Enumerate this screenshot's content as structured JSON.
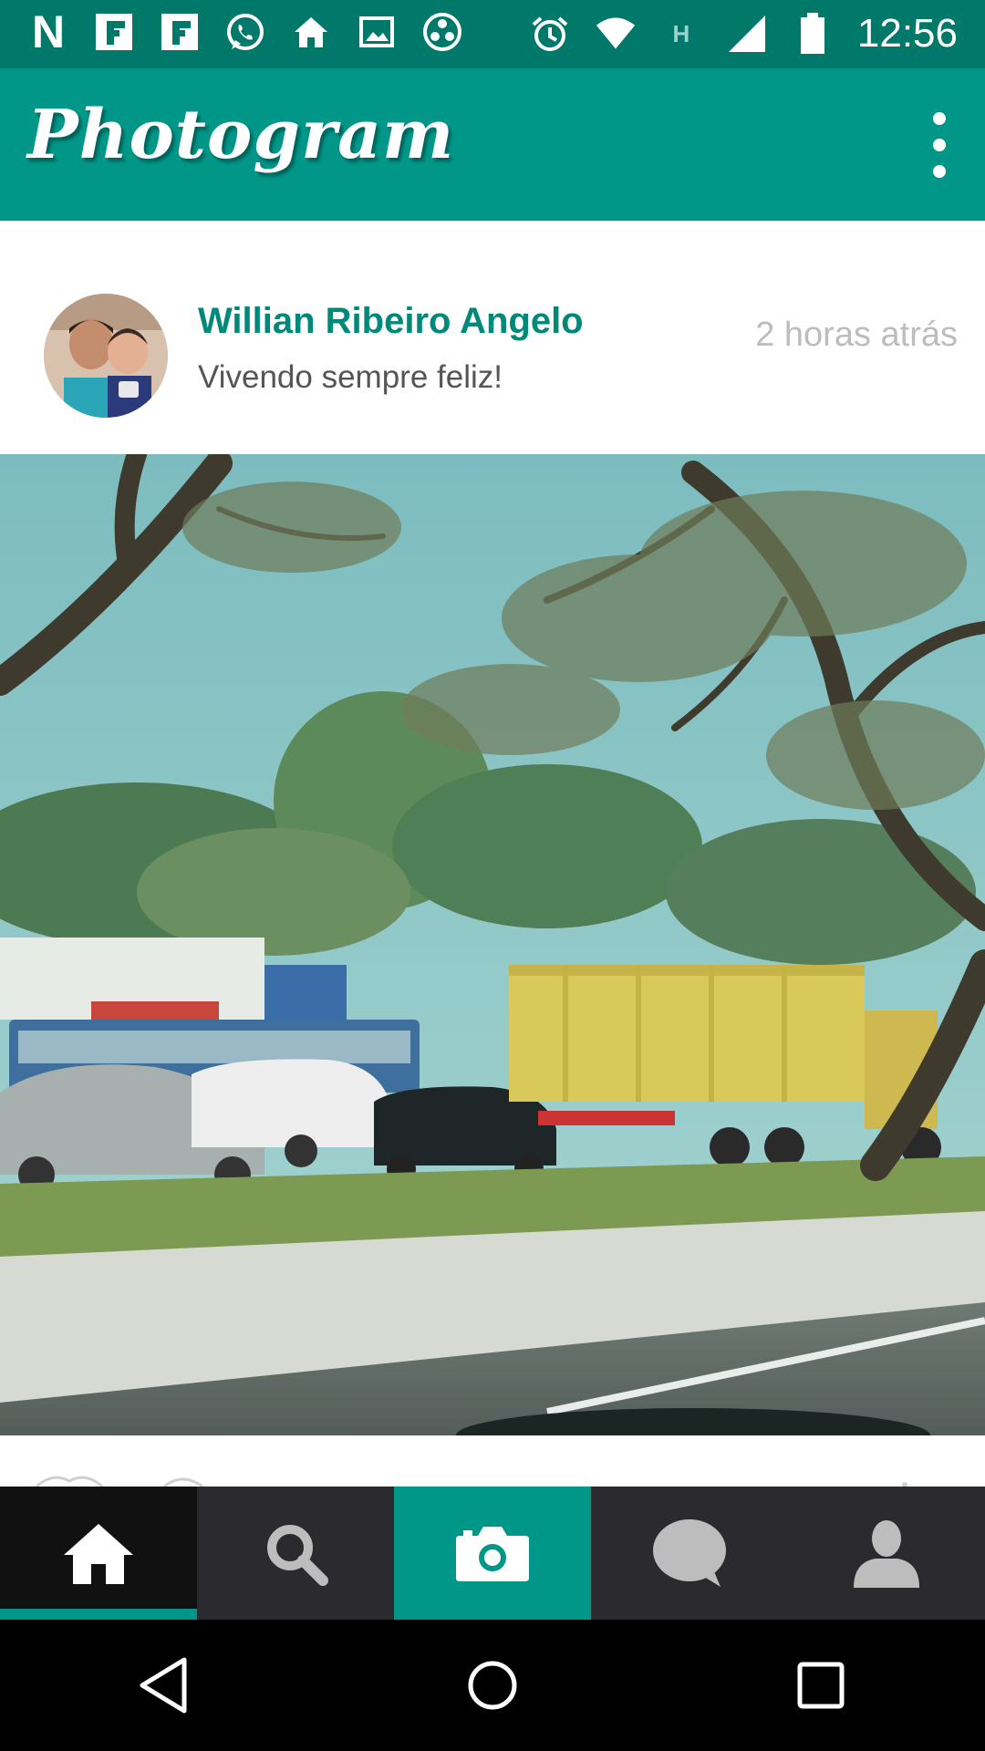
{
  "status_bar": {
    "time": "12:56",
    "left_icons": [
      "n-icon",
      "flipboard-icon",
      "flipboard-icon",
      "whatsapp-icon",
      "home-icon",
      "gallery-icon",
      "reel-icon"
    ],
    "right_icons": [
      "alarm-icon",
      "wifi-icon",
      "h-signal-icon",
      "cell-signal-icon",
      "battery-icon"
    ],
    "n_letter": "N",
    "h_letter": "H"
  },
  "app_bar": {
    "title": "Photogram"
  },
  "post": {
    "author": "Willian Ribeiro Angelo",
    "caption": "Vivendo sempre feliz!",
    "time": "2 horas atrás"
  },
  "bottom_nav": {
    "tabs": [
      {
        "name": "home",
        "active": true
      },
      {
        "name": "search",
        "active": false
      },
      {
        "name": "camera",
        "active": false
      },
      {
        "name": "messages",
        "active": false
      },
      {
        "name": "profile",
        "active": false
      }
    ]
  },
  "colors": {
    "status_bar": "#00796b",
    "app_bar": "#009688",
    "accent": "#00897b",
    "nav_bg": "#2b2a2f",
    "nav_active": "#111111"
  }
}
